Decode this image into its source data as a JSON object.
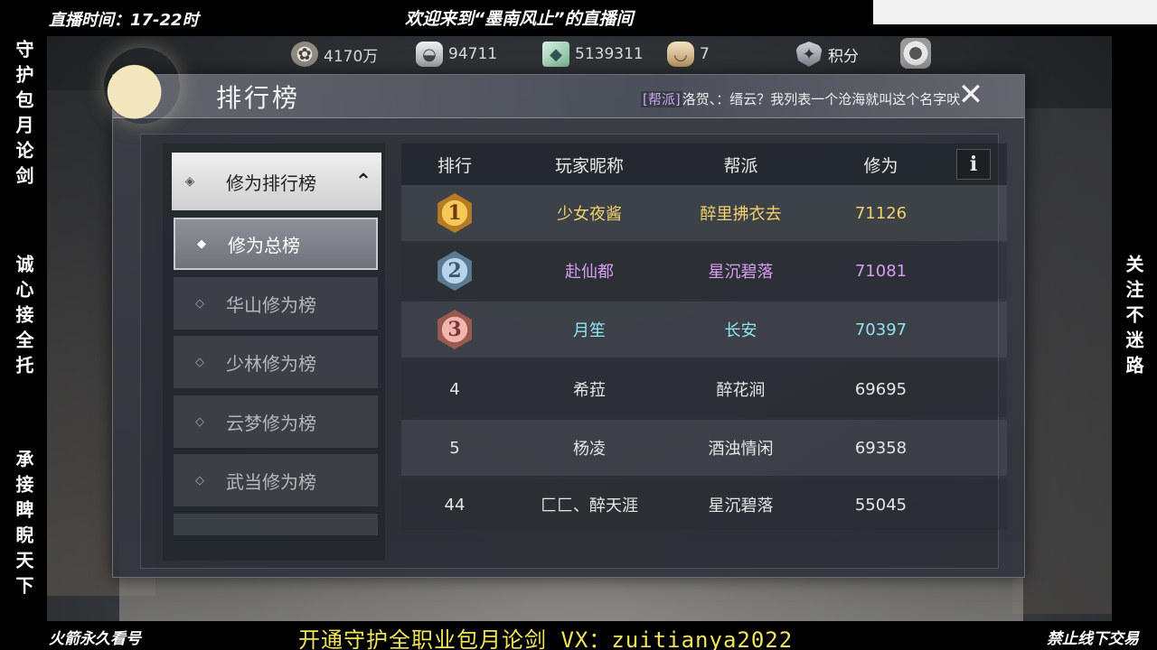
{
  "stream": {
    "time_text": "直播时间：17-22时",
    "welcome_text": "欢迎来到“墨南风止”的直播间",
    "left_vertical_1": "守护包月论剑",
    "left_vertical_2": "诚心接全托",
    "left_vertical_3": "承接睥睨天下",
    "right_vertical": "关注不迷路",
    "bottom_left": "火箭永久看号",
    "bottom_center": "开通守护全职业包月论剑  VX：zuitianya2022",
    "bottom_right": "禁止线下交易"
  },
  "currency": [
    {
      "icon": "coin-icon",
      "value": "4170万"
    },
    {
      "icon": "silver-ingot-icon",
      "value": "94711"
    },
    {
      "icon": "jade-icon",
      "value": "5139311"
    },
    {
      "icon": "bowl-icon",
      "value": "7"
    },
    {
      "icon": "shield-icon",
      "value": "积分"
    }
  ],
  "panel": {
    "title": "排行榜",
    "chat_tag": "[帮派]",
    "chat_text": "洛贺、：缙云？我列表一个沧海就叫这个名字吠",
    "close_label": "✕"
  },
  "menu": {
    "header_label": "修为排行榜",
    "items": [
      {
        "label": "修为总榜",
        "active": true
      },
      {
        "label": "华山修为榜"
      },
      {
        "label": "少林修为榜"
      },
      {
        "label": "云梦修为榜"
      },
      {
        "label": "武当修为榜"
      }
    ]
  },
  "table": {
    "headers": {
      "rank": "排行",
      "name": "玩家昵称",
      "guild": "帮派",
      "score": "修为",
      "info": "i"
    },
    "rows": [
      {
        "rank": "1",
        "name": "少女夜酱",
        "guild": "醉里拂衣去",
        "score": "71126",
        "color": "#f2cf6e"
      },
      {
        "rank": "2",
        "name": "赴仙都",
        "guild": "星沉碧落",
        "score": "71081",
        "color": "#d79df2"
      },
      {
        "rank": "3",
        "name": "月笙",
        "guild": "长安",
        "score": "70397",
        "color": "#8fe2f0"
      },
      {
        "rank": "4",
        "name": "希菈",
        "guild": "醉花涧",
        "score": "69695",
        "color": "#e4e6e8"
      },
      {
        "rank": "5",
        "name": "杨凌",
        "guild": "酒浊情闲",
        "score": "69358",
        "color": "#e4e6e8"
      },
      {
        "rank": "44",
        "name": "匚匚、醉天涯",
        "guild": "星沉碧落",
        "score": "55045",
        "color": "#e4e6e8"
      }
    ]
  }
}
